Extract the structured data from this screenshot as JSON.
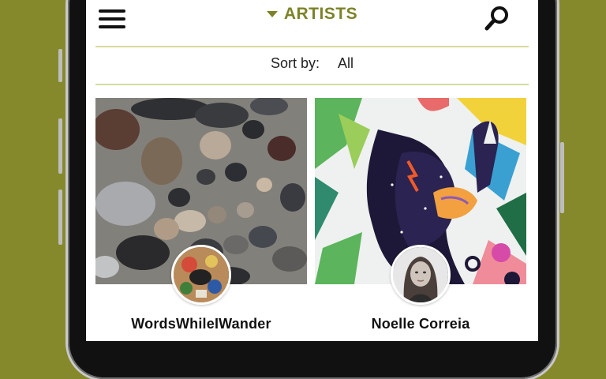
{
  "header": {
    "title": "ARTISTS",
    "menu_icon": "hamburger-menu-icon",
    "search_icon": "search-icon"
  },
  "sort": {
    "label": "Sort by:",
    "value": "All"
  },
  "artists": [
    {
      "name": "WordsWhileIWander"
    },
    {
      "name": "Noelle Correia"
    }
  ],
  "colors": {
    "background": "#85892b",
    "accent": "#7d8228",
    "divider": "#d8db9b"
  }
}
